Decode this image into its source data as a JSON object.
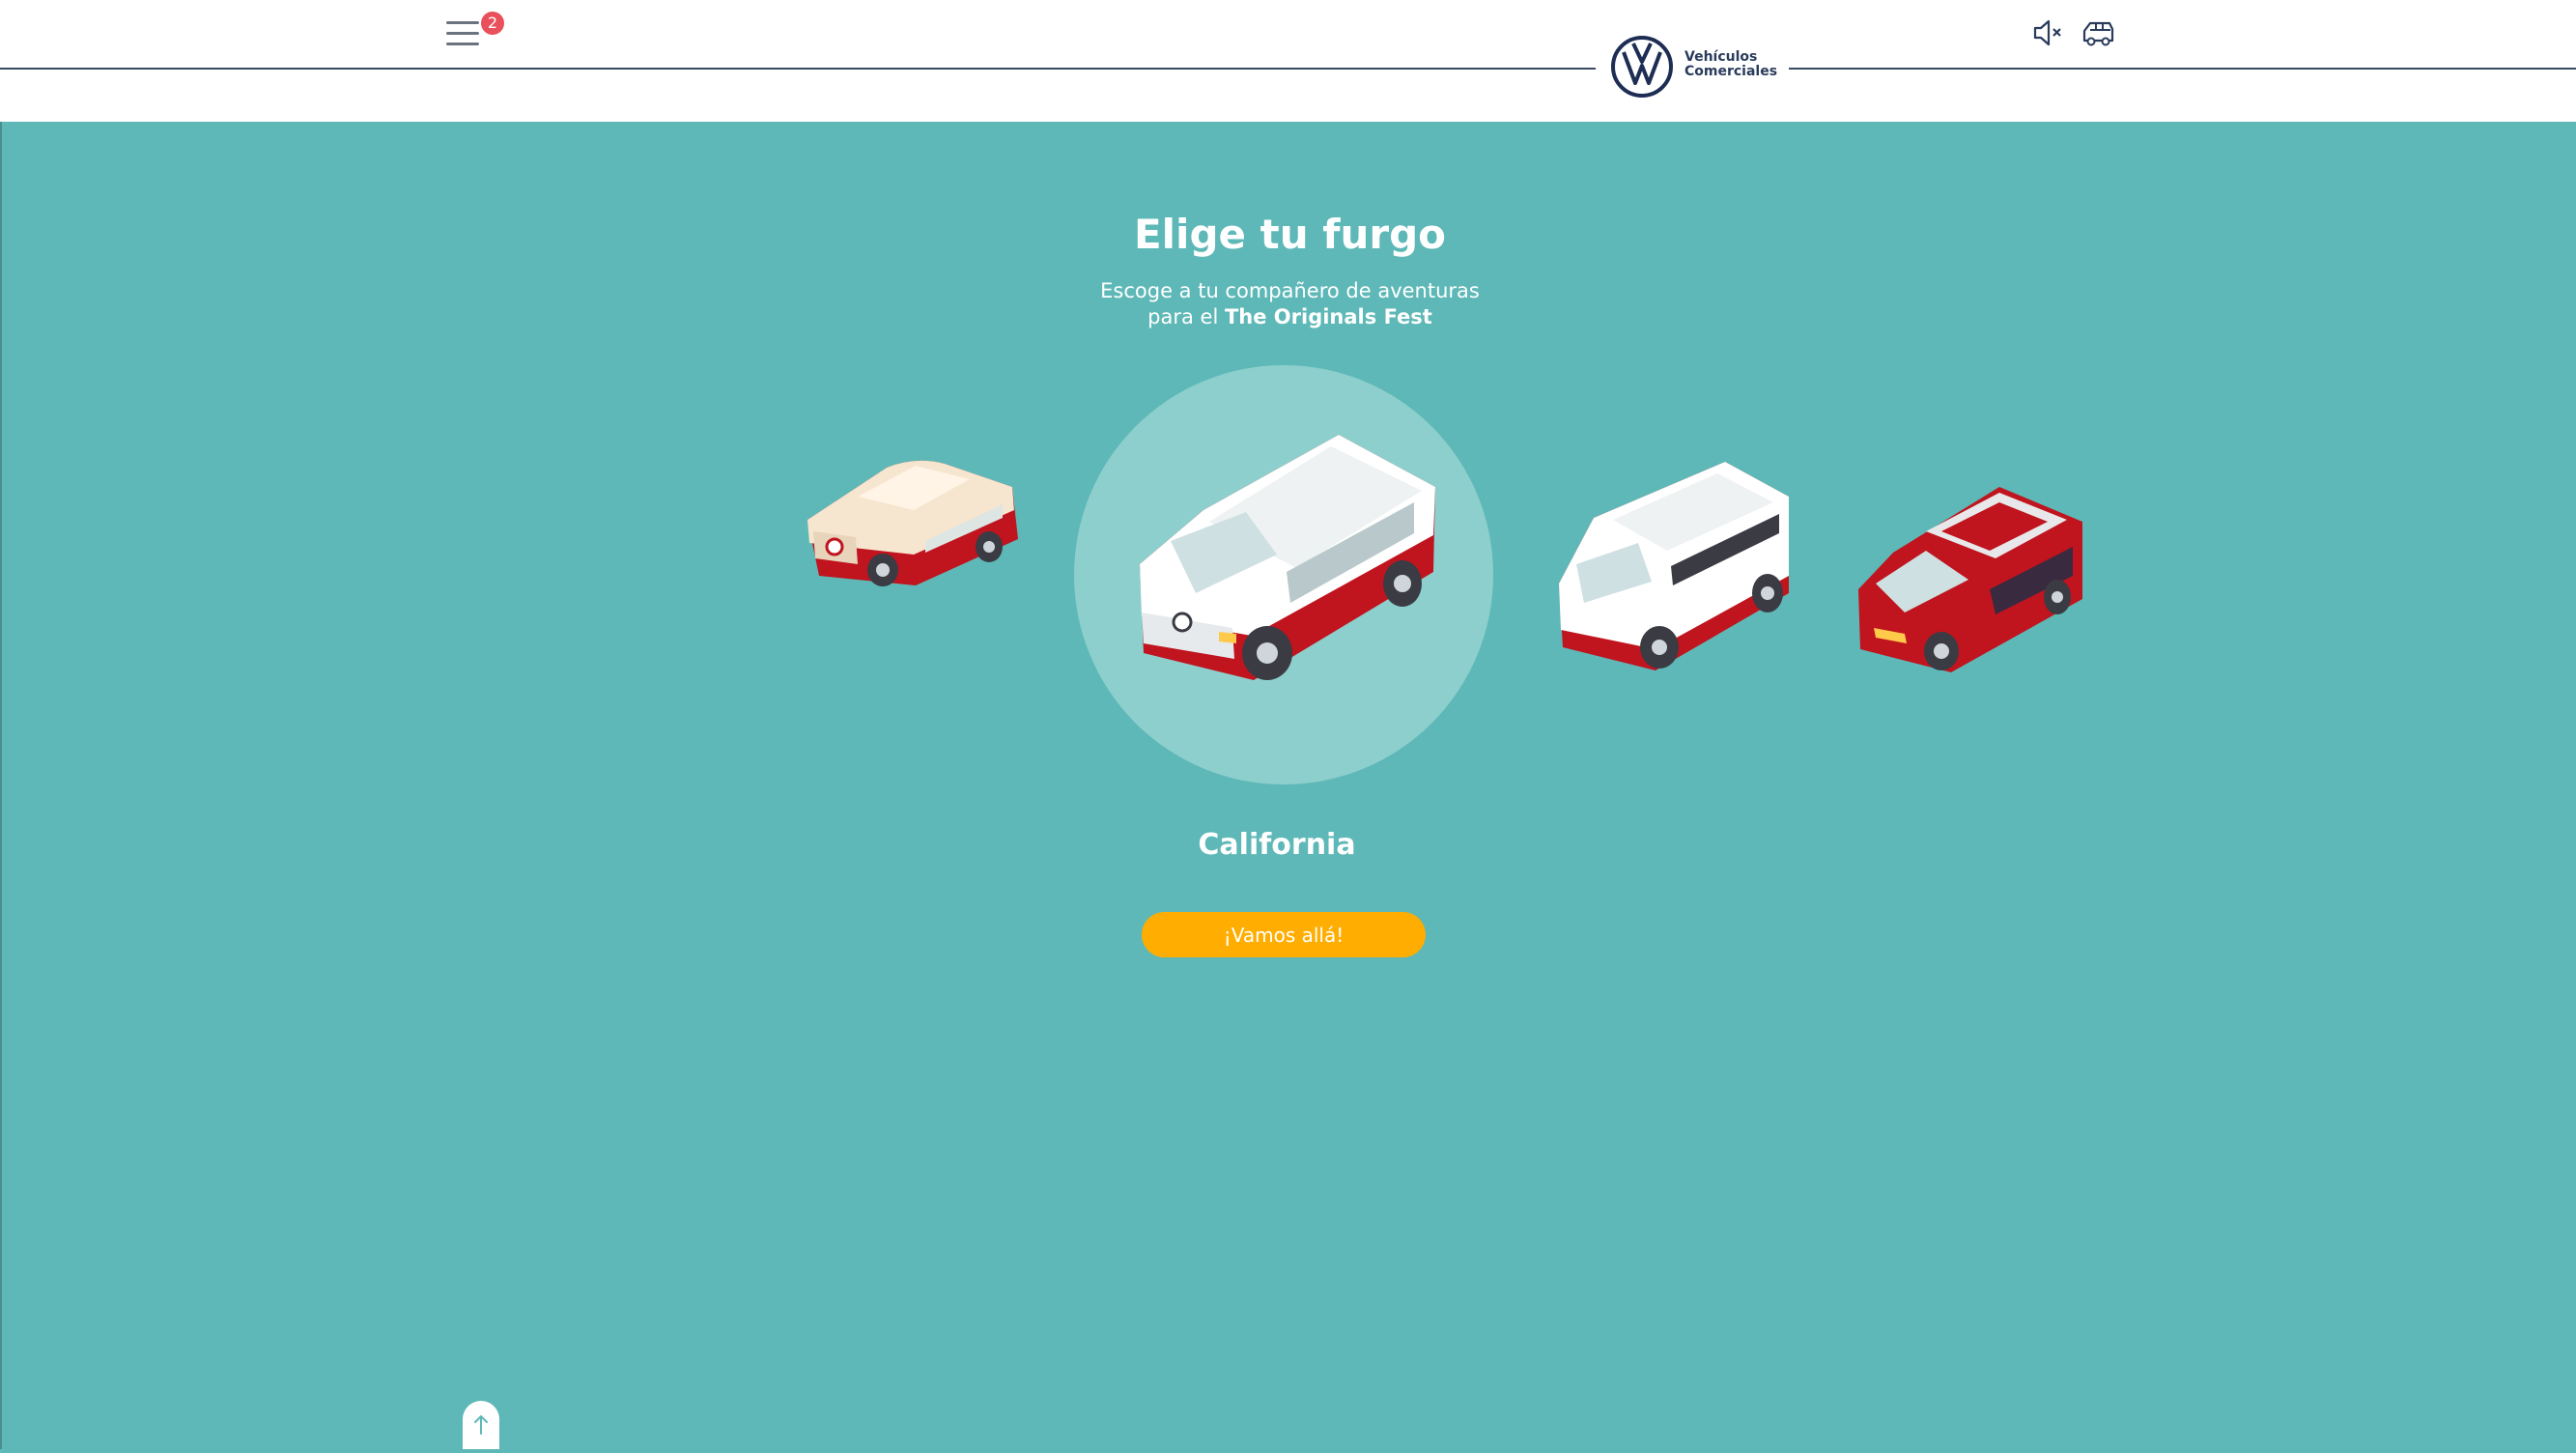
{
  "header": {
    "notification_count": "2",
    "brand_line1": "Vehículos",
    "brand_line2": "Comerciales",
    "icons": [
      "menu-icon",
      "volkswagen-logo-icon",
      "sound-muted-icon",
      "van-icon"
    ]
  },
  "main": {
    "title": "Elige tu furgo",
    "subtitle_line1": "Escoge a tu compañero de aventuras",
    "subtitle_line2_prefix": "para el ",
    "subtitle_line2_bold": "The Originals Fest",
    "selected_vehicle": "California",
    "cta_label": "¡Vamos allá!"
  },
  "colors": {
    "background": "#5eb8b7",
    "selected_circle": "#8dcfcc",
    "cta": "#ffad00",
    "badge": "#e8505b",
    "vehicle_red": "#c0141e",
    "brand_navy": "#1e2d54"
  }
}
